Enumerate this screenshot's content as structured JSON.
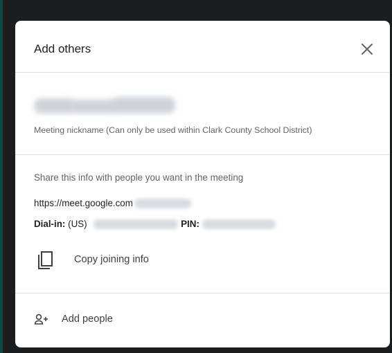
{
  "dialog": {
    "title": "Add others",
    "close_icon": "close-icon"
  },
  "meeting": {
    "nickname_caption": "Meeting nickname (Can only be used within Clark County School District)"
  },
  "share": {
    "caption": "Share this info with people you want in the meeting",
    "url_prefix": "https://meet.google.com",
    "dial_in_label": "Dial-in:",
    "dial_in_country": "(US)",
    "pin_label": "PIN:"
  },
  "actions": {
    "copy_label": "Copy joining info",
    "copy_icon": "copy-icon",
    "add_people_label": "Add people",
    "add_people_icon": "person-add-icon"
  }
}
